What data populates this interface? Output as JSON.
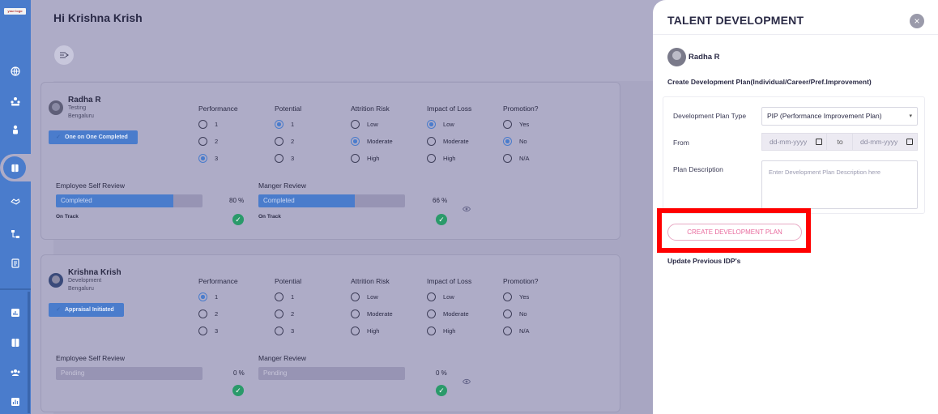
{
  "app": {
    "logo_text": "your logo"
  },
  "rail": {
    "icons": [
      "globe-icon",
      "org-icon",
      "person-icon",
      "talent-icon",
      "handshake-icon",
      "hierarchy-icon",
      "document-icon",
      "report-icon",
      "book-icon",
      "team-icon",
      "analytics-icon"
    ]
  },
  "header": {
    "greeting": "Hi Krishna Krish"
  },
  "cards": [
    {
      "name": "Radha R",
      "dept": "Testing",
      "location": "Bengaluru",
      "status": "One on One Completed",
      "groups": [
        {
          "title": "Performance",
          "options": [
            "1",
            "2",
            "3"
          ],
          "selected": 2
        },
        {
          "title": "Potential",
          "options": [
            "1",
            "2",
            "3"
          ],
          "selected": 0
        },
        {
          "title": "Attrition Risk",
          "options": [
            "Low",
            "Moderate",
            "High"
          ],
          "selected": 1
        },
        {
          "title": "Impact of Loss",
          "options": [
            "Low",
            "Moderate",
            "High"
          ],
          "selected": 0
        },
        {
          "title": "Promotion?",
          "options": [
            "Yes",
            "No",
            "N/A"
          ],
          "selected": 1
        }
      ],
      "self_review": {
        "label": "Employee Self Review",
        "status": "Completed",
        "percent": "80 %",
        "progress": 0.8,
        "track": "On Track"
      },
      "manager_review": {
        "label": "Manger Review",
        "status": "Completed",
        "percent": "66 %",
        "progress": 0.66,
        "track": "On Track"
      }
    },
    {
      "name": "Krishna Krish",
      "dept": "Development",
      "location": "Bengaluru",
      "status": "Appraisal Initiated",
      "groups": [
        {
          "title": "Performance",
          "options": [
            "1",
            "2",
            "3"
          ],
          "selected": 0
        },
        {
          "title": "Potential",
          "options": [
            "1",
            "2",
            "3"
          ],
          "selected": -1
        },
        {
          "title": "Attrition Risk",
          "options": [
            "Low",
            "Moderate",
            "High"
          ],
          "selected": -1
        },
        {
          "title": "Impact of Loss",
          "options": [
            "Low",
            "Moderate",
            "High"
          ],
          "selected": -1
        },
        {
          "title": "Promotion?",
          "options": [
            "Yes",
            "No",
            "N/A"
          ],
          "selected": -1
        }
      ],
      "self_review": {
        "label": "Employee Self Review",
        "status": "Pending",
        "percent": "0 %",
        "progress": 0,
        "track": ""
      },
      "manager_review": {
        "label": "Manger Review",
        "status": "Pending",
        "percent": "0 %",
        "progress": 0,
        "track": ""
      }
    }
  ],
  "drawer": {
    "title": "TALENT DEVELOPMENT",
    "close_label": "×",
    "employee_name": "Radha R",
    "subtitle": "Create Development Plan(Individual/Career/Pref.Improvement)",
    "plan_type_label": "Development Plan Type",
    "plan_type_value": "PIP (Performance Improvement Plan)",
    "from_label": "From",
    "date_placeholder": "dd-mm-yyyy",
    "to_label": "to",
    "description_label": "Plan Description",
    "description_placeholder": "Enter Development Plan Description here",
    "create_button": "CREATE DEVELOPMENT PLAN",
    "update_link": "Update Previous IDP's"
  },
  "colors": {
    "accent": "#4a7ccc",
    "highlight": "#ff0000",
    "button_text": "#e86a9d",
    "success": "#2a9a6a"
  }
}
